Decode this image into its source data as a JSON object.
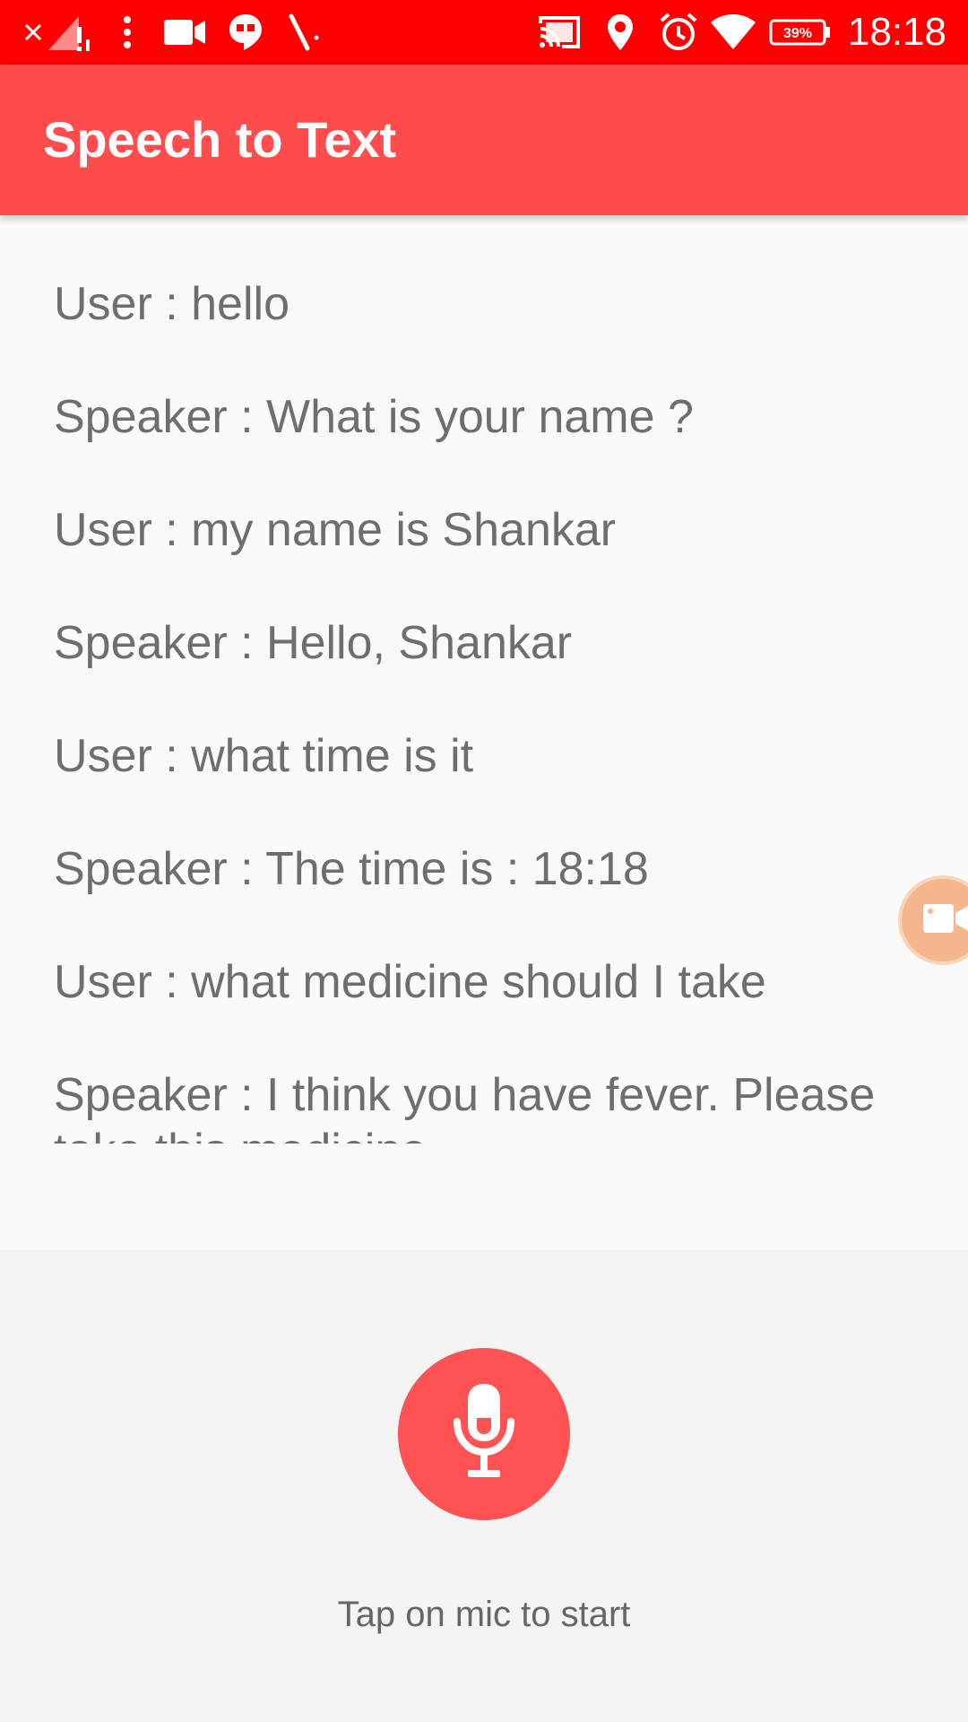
{
  "status_bar": {
    "time": "18:18",
    "battery": "39%",
    "background_color": "#ff0000",
    "icons": [
      "close-icon",
      "no-signal-icon",
      "more-vert-icon",
      "video-camera-icon",
      "hangouts-icon",
      "pencil-icon",
      "cast-icon",
      "location-icon",
      "alarm-icon",
      "wifi-icon",
      "battery-icon"
    ]
  },
  "app_bar": {
    "title": "Speech to Text",
    "background_color": "#ff4d4d"
  },
  "conversation": {
    "messages": [
      {
        "text": "User : hello"
      },
      {
        "text": "Speaker : What is your name ?"
      },
      {
        "text": "User : my name is Shankar"
      },
      {
        "text": "Speaker : Hello, Shankar"
      },
      {
        "text": "User : what time is it"
      },
      {
        "text": "Speaker : The time is : 18:18"
      },
      {
        "text": "User : what medicine should I take"
      },
      {
        "text": "Speaker : I think you have fever. Please take this medicine"
      }
    ]
  },
  "floating_bubble": {
    "icon": "video-camera-icon",
    "color": "#f4b68a"
  },
  "controls": {
    "mic_icon": "microphone-icon",
    "mic_color": "#ff5252",
    "hint": "Tap on mic to start"
  }
}
